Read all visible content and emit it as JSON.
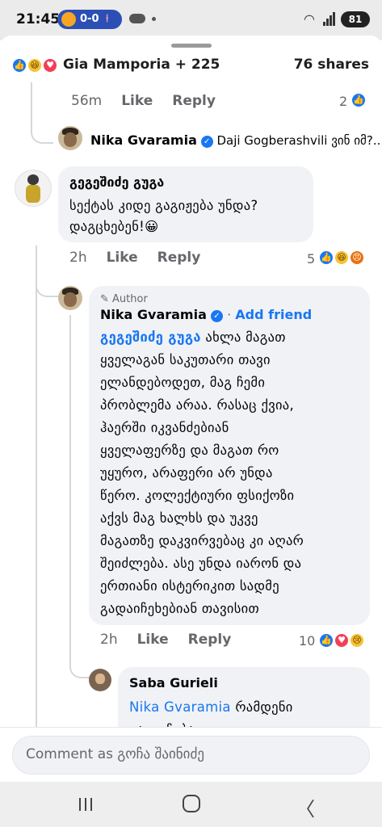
{
  "status_bar": {
    "time": "21:45",
    "score": "0-0",
    "battery": "81"
  },
  "summary": {
    "names": "Gia Mamporia + 225",
    "shares": "76 shares"
  },
  "comments": [
    {
      "time": "56m",
      "like": "Like",
      "reply": "Reply",
      "count": "2"
    },
    {
      "preview_name": "Nika Gvaramia",
      "preview_text": "Daji Gogberashvili ვინ იმ?..."
    },
    {
      "author": "გეგეშიძე გუგა",
      "lines": [
        "სექტას კიდე გაგიჟება უნდა?",
        "დაგცხებენ!😀"
      ],
      "time": "2h",
      "like": "Like",
      "reply": "Reply",
      "count": "5"
    },
    {
      "badge": "Author",
      "author": "Nika Gvaramia",
      "add_friend": "Add friend",
      "mention": "გეგეშიძე გუგა",
      "lines": [
        "ახლა მაგათ",
        "ყველაგან საკუთარი თავი",
        "ელანდებოდეთ, მაგ ჩემი",
        "პრობლემა არაა. რასაც ქვია,",
        "ჰაერში იკვანძებიან",
        "ყველაფერზე და მაგათ რო",
        "უყურო, არაფერი არ უნდა",
        "წერო. კოლექტიური ფსიქოზი",
        "აქვს მაგ ხალხს და უკვე",
        "მაგათზე დაკვირვებაც კი აღარ",
        "შეიძლება. ასე უნდა იარონ და",
        "ერთიანი ისტერიკით სადმე",
        "გადაიჩეხებიან თავისით"
      ],
      "time": "2h",
      "like": "Like",
      "reply": "Reply",
      "count": "10"
    },
    {
      "author": "Saba Gurieli",
      "mention": "Nika Gvaramia",
      "text": "რამდენი",
      "cut_line": "გაიგიჩება"
    }
  ],
  "comment_input": {
    "placeholder": "Comment as გოჩა შაინიძე"
  }
}
